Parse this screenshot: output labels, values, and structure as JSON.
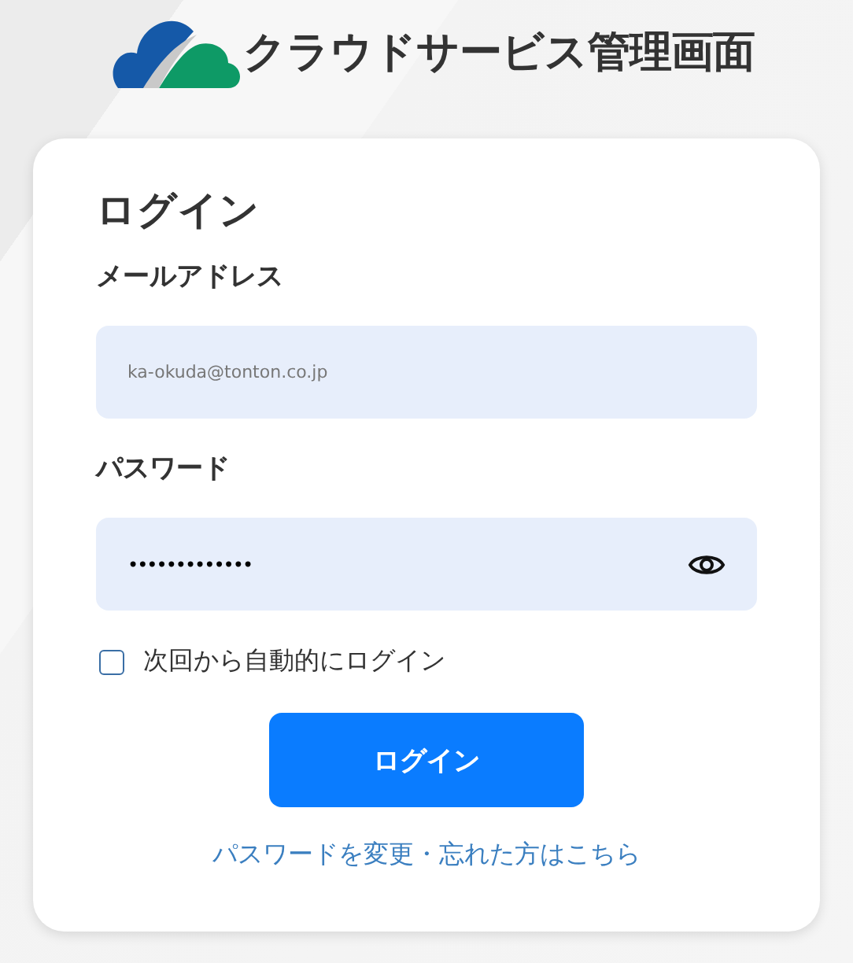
{
  "header": {
    "title": "クラウドサービス管理画面"
  },
  "login_form": {
    "heading": "ログイン",
    "fields": [
      {
        "kind": "text",
        "label": "メールアドレス",
        "value": "ka-okuda@tonton.co.jp"
      },
      {
        "kind": "password",
        "label": "パスワード",
        "value": "•••••••••••••"
      }
    ],
    "remember": {
      "label": "次回から自動的にログイン",
      "checked": false
    },
    "submit": "ログイン",
    "link": "パスワードを変更・忘れた方はこちら"
  }
}
